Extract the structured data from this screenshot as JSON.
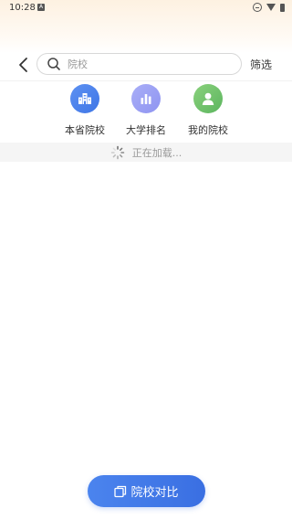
{
  "status_bar": {
    "time": "10:28",
    "notification_icon": "a-notification-icon",
    "dnd_icon": "dnd-icon",
    "wifi_icon": "wifi-icon",
    "battery_icon": "battery-icon"
  },
  "header": {
    "back_icon": "chevron-left-icon",
    "search": {
      "placeholder": "院校",
      "value": "",
      "icon": "search-icon"
    },
    "filter_label": "筛选"
  },
  "nav_items": [
    {
      "label": "本省院校",
      "icon": "school-building-icon",
      "color": "#4a82ee"
    },
    {
      "label": "大学排名",
      "icon": "bar-chart-icon",
      "color": "#9ea3f5"
    },
    {
      "label": "我的院校",
      "icon": "user-icon",
      "color": "#74c46d"
    }
  ],
  "loading": {
    "text": "正在加载...",
    "icon": "spinner-icon"
  },
  "compare_button": {
    "label": "院校对比",
    "icon": "compare-icon",
    "color": "#4178e8"
  }
}
